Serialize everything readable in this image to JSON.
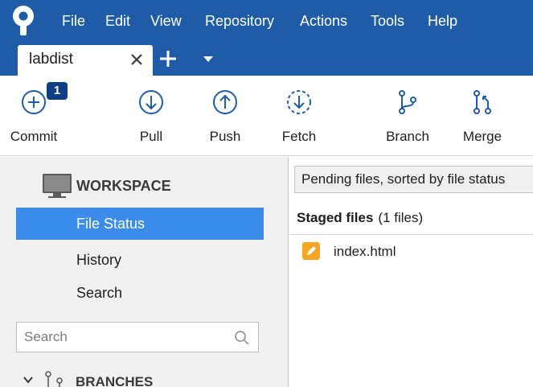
{
  "menu": [
    "File",
    "Edit",
    "View",
    "Repository",
    "Actions",
    "Tools",
    "Help"
  ],
  "tab": {
    "label": "labdist"
  },
  "toolbar": {
    "commit": {
      "label": "Commit",
      "badge": "1"
    },
    "pull": {
      "label": "Pull"
    },
    "push": {
      "label": "Push"
    },
    "fetch": {
      "label": "Fetch"
    },
    "branch": {
      "label": "Branch"
    },
    "merge": {
      "label": "Merge"
    }
  },
  "sidebar": {
    "workspace_title": "WORKSPACE",
    "items": [
      {
        "label": "File Status",
        "active": true
      },
      {
        "label": "History",
        "active": false
      },
      {
        "label": "Search",
        "active": false
      }
    ],
    "search_placeholder": "Search",
    "branches_title": "BRANCHES"
  },
  "main": {
    "sort_label": "Pending files, sorted by file status",
    "staged_title": "Staged files",
    "staged_count": "(1 files)",
    "files": [
      {
        "name": "index.html",
        "status": "modified"
      }
    ]
  },
  "colors": {
    "titlebar": "#1f5ca8",
    "selection": "#3b8cea",
    "badge": "#0f3e86",
    "modified": "#f5a623"
  }
}
